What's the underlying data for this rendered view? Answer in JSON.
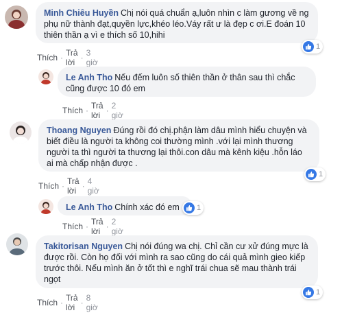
{
  "comments": [
    {
      "author": "Minh Chiêu Huyền",
      "text": "Chị nói quá chuẩn ạ,luôn nhìn c làm gương về ng phụ nữ thành đạt,quyền lực,khéo léo.Váy rất ư là đẹp c ơi.E đoán 10 thiên thần ạ vì e thích số 10,hihi",
      "like": "Thích",
      "reply": "Trả lời",
      "time": "3 giờ",
      "reactions": "1"
    },
    {
      "author": "Le Anh Tho",
      "text": "Nếu đếm luôn số thiên thần ở thân sau thì chắc cũng được 10 đó em",
      "like": "Thích",
      "reply": "Trả lời",
      "time": "2 giờ"
    },
    {
      "author": "Thoang Nguyen",
      "text": "Đúng rồi đó chị.phận làm dâu mình hiểu chuyện và biết điều là người ta không coi thường mình .với lại mình thương người ta thì người ta thương lại thôi.con dâu mà kênh kiệu .hỗn láo ai mà chấp nhận được .",
      "like": "Thích",
      "reply": "Trả lời",
      "time": "4 giờ",
      "reactions": "1"
    },
    {
      "author": "Le Anh Tho",
      "text": "Chính xác đó em",
      "like": "Thích",
      "reply": "Trả lời",
      "time": "2 giờ",
      "reactions": "1"
    },
    {
      "author": "Takitorisan Nguyen",
      "text": "Chị nói đúng wa chị. Chỉ cần cư xử đúng mực là được rồi. Còn họ đối với mình ra sao cũng do cái quả mình gieo kiếp trước thôi. Nếu mình ăn ở tốt thì e nghĩ trái chua sẽ mau thành trái ngọt",
      "like": "Thích",
      "reply": "Trả lời",
      "time": "8 giờ",
      "reactions": "1"
    }
  ],
  "colors": {
    "author": "#385898",
    "bubble": "#f2f3f5",
    "like_badge": "#3578e5",
    "meta": "#90949c"
  },
  "icons": {
    "like": "thumbs-up-icon"
  }
}
